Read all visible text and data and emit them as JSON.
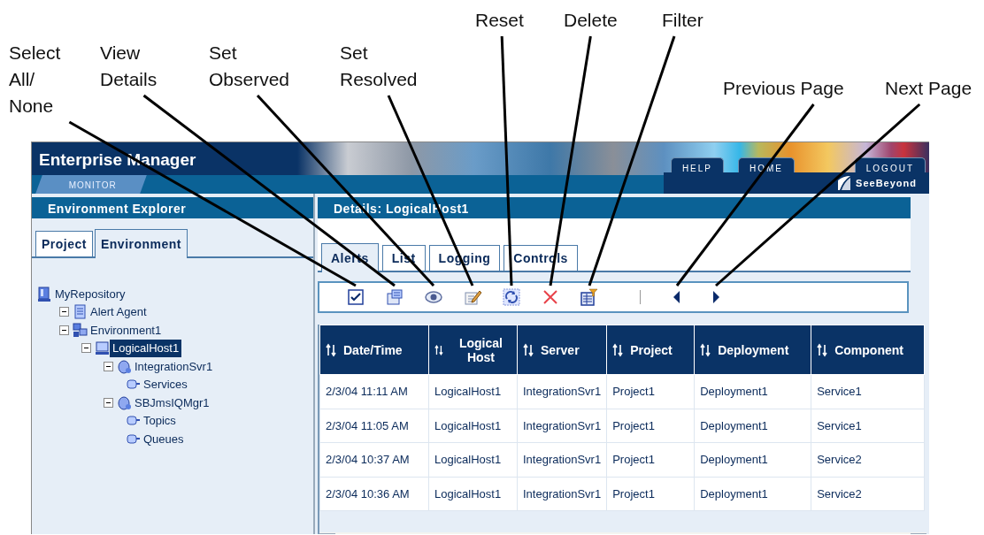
{
  "app": {
    "title": "Enterprise Manager",
    "header_tabs": [
      "HELP",
      "HOME",
      "LOGOUT"
    ],
    "section_tab": "MONITOR",
    "logo_text": "SeeBeyond"
  },
  "explorer": {
    "title": "Environment Explorer",
    "tabs": [
      {
        "label": "Project",
        "selected": false
      },
      {
        "label": "Environment",
        "selected": true
      }
    ],
    "tree": [
      {
        "label": "MyRepository",
        "kind": "repository",
        "selected": false,
        "children": [
          {
            "label": "Alert Agent",
            "kind": "agent",
            "selected": false,
            "expanded": true
          },
          {
            "label": "Environment1",
            "kind": "environment",
            "selected": false,
            "expanded": true,
            "children": [
              {
                "label": "LogicalHost1",
                "kind": "host",
                "selected": true,
                "expanded": true,
                "children": [
                  {
                    "label": "IntegrationSvr1",
                    "kind": "server",
                    "selected": false,
                    "expanded": true,
                    "children": [
                      {
                        "label": "Services",
                        "kind": "service",
                        "selected": false
                      }
                    ]
                  },
                  {
                    "label": "SBJmsIQMgr1",
                    "kind": "server",
                    "selected": false,
                    "expanded": true,
                    "children": [
                      {
                        "label": "Topics",
                        "kind": "service",
                        "selected": false
                      },
                      {
                        "label": "Queues",
                        "kind": "service",
                        "selected": false
                      }
                    ]
                  }
                ]
              }
            ]
          }
        ]
      }
    ]
  },
  "details": {
    "title": "Details: LogicalHost1",
    "tabs": [
      {
        "label": "Alerts",
        "selected": true
      },
      {
        "label": "List",
        "selected": false
      },
      {
        "label": "Logging",
        "selected": false
      },
      {
        "label": "Controls",
        "selected": false
      }
    ],
    "toolbar": [
      {
        "kind": "select_all",
        "callout": "Select All/ None"
      },
      {
        "kind": "view_details",
        "callout": "View Details"
      },
      {
        "kind": "set_observed",
        "callout": "Set Observed"
      },
      {
        "kind": "set_resolved",
        "callout": "Set Resolved"
      },
      {
        "kind": "reset",
        "callout": "Reset"
      },
      {
        "kind": "delete",
        "callout": "Delete"
      },
      {
        "kind": "filter",
        "callout": "Filter"
      },
      {
        "kind": "separator"
      },
      {
        "kind": "previous",
        "callout": "Previous Page"
      },
      {
        "kind": "next",
        "callout": "Next Page"
      }
    ],
    "table": {
      "columns": [
        "Date/Time",
        "Logical Host",
        "Server",
        "Project",
        "Deployment",
        "Component"
      ],
      "rows": [
        [
          "2/3/04 11:11 AM",
          "LogicalHost1",
          "IntegrationSvr1",
          "Project1",
          "Deployment1",
          "Service1"
        ],
        [
          "2/3/04 11:05 AM",
          "LogicalHost1",
          "IntegrationSvr1",
          "Project1",
          "Deployment1",
          "Service1"
        ],
        [
          "2/3/04 10:37 AM",
          "LogicalHost1",
          "IntegrationSvr1",
          "Project1",
          "Deployment1",
          "Service2"
        ],
        [
          "2/3/04 10:36 AM",
          "LogicalHost1",
          "IntegrationSvr1",
          "Project1",
          "Deployment1",
          "Service2"
        ]
      ]
    }
  }
}
